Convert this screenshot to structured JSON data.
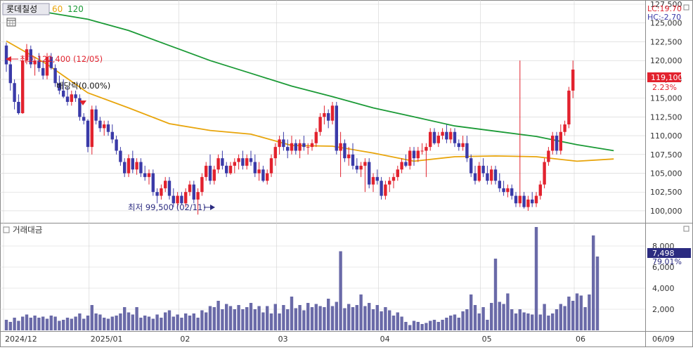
{
  "header": {
    "stock_name": "롯데칠성",
    "ma_short_label": "60",
    "ma_long_label": "120",
    "lc_label": "LC:19.70",
    "hc_label": "HC:-2.70",
    "volume_title": "거래대금"
  },
  "colors": {
    "up": "#e2222e",
    "down": "#3a3aa8",
    "ma60": "#e8a50c",
    "ma120": "#1b9a36",
    "volume": "#6a6aa8",
    "grid": "#d2d2d2",
    "current_tag": "#e2222e",
    "volume_tag": "#2b2b80"
  },
  "annotations": {
    "high_label": "최고 122,400 (12/05)",
    "low_label": "최저 99,500 (02/11)",
    "dividend_label": "배당락(0.00%)",
    "current_price_tag": "119,100",
    "current_change": "2.23%",
    "volume_tag": "7,498",
    "volume_change": "79.01%"
  },
  "chart_data": [
    {
      "type": "candlestick",
      "title": "롯데칠성",
      "ylim": [
        98500,
        127500
      ],
      "y_ticks": [
        100000,
        102500,
        105000,
        107500,
        110000,
        112500,
        115000,
        117500,
        120000,
        122500,
        125000,
        127500
      ],
      "y_tick_labels": [
        "100,000",
        "102,500",
        "105,000",
        "107,500",
        "110,000",
        "112,500",
        "115,000",
        "117,500",
        "120,000",
        "122,500",
        "125,000",
        "127,500"
      ],
      "x_tick_labels": [
        "2024/12",
        "2025/01",
        "02",
        "03",
        "04",
        "05",
        "06",
        "06/09"
      ],
      "x_tick_indices": [
        0,
        21,
        43,
        67,
        92,
        117,
        140,
        152
      ],
      "candles": [
        [
          122000,
          122400,
          118500,
          119500
        ],
        [
          119500,
          120500,
          116000,
          117000
        ],
        [
          117000,
          117500,
          113500,
          114500
        ],
        [
          114500,
          115500,
          112800,
          113000
        ],
        [
          113000,
          120500,
          112900,
          120000
        ],
        [
          120000,
          122200,
          119500,
          121500
        ],
        [
          121500,
          122000,
          119000,
          119500
        ],
        [
          119500,
          120500,
          118000,
          120000
        ],
        [
          120000,
          121000,
          118500,
          119000
        ],
        [
          119000,
          120000,
          117500,
          118000
        ],
        [
          118000,
          121000,
          117500,
          120500
        ],
        [
          120500,
          121000,
          118800,
          119000
        ],
        [
          119000,
          119500,
          116500,
          117000
        ],
        [
          117000,
          118000,
          115500,
          116000
        ],
        [
          116000,
          117500,
          115000,
          115200
        ],
        [
          115200,
          116500,
          114000,
          114500
        ],
        [
          114500,
          116000,
          114000,
          115500
        ],
        [
          115500,
          116000,
          114500,
          115000
        ],
        [
          115000,
          115500,
          112000,
          112500
        ],
        [
          112500,
          113000,
          111500,
          112000
        ],
        [
          112000,
          112200,
          107800,
          108500
        ],
        [
          108500,
          114000,
          107500,
          113500
        ],
        [
          113500,
          114000,
          111500,
          112000
        ],
        [
          112000,
          112500,
          110500,
          111000
        ],
        [
          111000,
          112000,
          110000,
          111500
        ],
        [
          111500,
          112000,
          110000,
          110500
        ],
        [
          110500,
          111500,
          109000,
          109500
        ],
        [
          109500,
          110000,
          107500,
          108000
        ],
        [
          108000,
          108500,
          106000,
          106500
        ],
        [
          106500,
          107000,
          104500,
          105000
        ],
        [
          105000,
          107500,
          104500,
          107000
        ],
        [
          107000,
          108000,
          105000,
          105500
        ],
        [
          105500,
          107000,
          104800,
          106500
        ],
        [
          106500,
          107000,
          104500,
          105000
        ],
        [
          105000,
          106000,
          104000,
          104500
        ],
        [
          104500,
          105500,
          103500,
          105000
        ],
        [
          105000,
          105500,
          102000,
          102500
        ],
        [
          102500,
          103000,
          101000,
          102000
        ],
        [
          102000,
          103500,
          101500,
          103000
        ],
        [
          103000,
          104500,
          102500,
          104000
        ],
        [
          104000,
          104500,
          101500,
          102000
        ],
        [
          102000,
          103000,
          100500,
          101000
        ],
        [
          101000,
          102500,
          100500,
          102000
        ],
        [
          102000,
          102500,
          100800,
          101000
        ],
        [
          101000,
          103000,
          100500,
          102500
        ],
        [
          102500,
          104000,
          102000,
          103500
        ],
        [
          103500,
          104000,
          101000,
          101500
        ],
        [
          101500,
          103000,
          99500,
          102500
        ],
        [
          102500,
          105000,
          102000,
          104500
        ],
        [
          104500,
          106500,
          104000,
          106000
        ],
        [
          106000,
          107500,
          103500,
          104000
        ],
        [
          104000,
          106000,
          103500,
          105500
        ],
        [
          105500,
          107500,
          105000,
          107000
        ],
        [
          107000,
          108000,
          105500,
          106000
        ],
        [
          106000,
          106500,
          104500,
          105000
        ],
        [
          105000,
          106500,
          104800,
          106000
        ],
        [
          106000,
          107000,
          105000,
          106500
        ],
        [
          106500,
          107500,
          105500,
          107000
        ],
        [
          107000,
          108000,
          105500,
          106000
        ],
        [
          106000,
          107500,
          105500,
          107000
        ],
        [
          107000,
          108000,
          106000,
          106500
        ],
        [
          106500,
          107500,
          104500,
          105000
        ],
        [
          105000,
          106500,
          104000,
          105500
        ],
        [
          105500,
          106000,
          103800,
          104000
        ],
        [
          104000,
          105500,
          103500,
          105000
        ],
        [
          105000,
          107500,
          104500,
          107000
        ],
        [
          107000,
          109000,
          106000,
          108500
        ],
        [
          108500,
          110000,
          107500,
          109500
        ],
        [
          109500,
          110500,
          108000,
          108500
        ],
        [
          108500,
          109500,
          107000,
          108000
        ],
        [
          108000,
          110000,
          107500,
          109000
        ],
        [
          109000,
          109500,
          107500,
          108000
        ],
        [
          108000,
          109500,
          107000,
          109000
        ],
        [
          109000,
          110000,
          108000,
          108500
        ],
        [
          108500,
          109000,
          107500,
          108500
        ],
        [
          108500,
          109500,
          108000,
          109000
        ],
        [
          109000,
          111000,
          108500,
          110500
        ],
        [
          110500,
          113000,
          110000,
          112500
        ],
        [
          112500,
          114000,
          111500,
          113000
        ],
        [
          113000,
          113500,
          111000,
          112000
        ],
        [
          112000,
          114500,
          111500,
          114000
        ],
        [
          114000,
          114500,
          107500,
          108000
        ],
        [
          108000,
          110500,
          104500,
          109000
        ],
        [
          109000,
          109500,
          106500,
          107000
        ],
        [
          107000,
          108500,
          106000,
          107500
        ],
        [
          107500,
          109000,
          105500,
          106000
        ],
        [
          106000,
          107000,
          105000,
          105500
        ],
        [
          105500,
          106500,
          104500,
          106000
        ],
        [
          106000,
          107000,
          102500,
          106500
        ],
        [
          106500,
          107000,
          103000,
          103500
        ],
        [
          103500,
          105000,
          102500,
          104500
        ],
        [
          104500,
          105500,
          103500,
          104000
        ],
        [
          104000,
          104500,
          101500,
          102000
        ],
        [
          102000,
          104000,
          101500,
          103500
        ],
        [
          103500,
          104500,
          102500,
          104000
        ],
        [
          104000,
          105000,
          103000,
          104500
        ],
        [
          104500,
          106000,
          104000,
          105500
        ],
        [
          105500,
          107000,
          105000,
          106500
        ],
        [
          106500,
          107500,
          105800,
          106000
        ],
        [
          106000,
          108500,
          105500,
          108000
        ],
        [
          108000,
          108500,
          106000,
          107000
        ],
        [
          107000,
          108500,
          106500,
          108000
        ],
        [
          108000,
          109000,
          107500,
          108000
        ],
        [
          108000,
          109000,
          104500,
          108500
        ],
        [
          108500,
          111000,
          108000,
          110500
        ],
        [
          110500,
          111000,
          108800,
          109000
        ],
        [
          109000,
          110500,
          108500,
          110000
        ],
        [
          110000,
          111000,
          109500,
          110500
        ],
        [
          110500,
          111500,
          109000,
          109500
        ],
        [
          109500,
          111000,
          109000,
          110500
        ],
        [
          110500,
          111000,
          108500,
          109000
        ],
        [
          109000,
          109500,
          108000,
          108500
        ],
        [
          108500,
          110000,
          108000,
          109000
        ],
        [
          109000,
          110000,
          106500,
          107000
        ],
        [
          107000,
          107500,
          104500,
          105000
        ],
        [
          105000,
          106000,
          103500,
          104000
        ],
        [
          104000,
          106500,
          103800,
          106000
        ],
        [
          106000,
          107000,
          104500,
          105000
        ],
        [
          105000,
          106000,
          103500,
          104000
        ],
        [
          104000,
          106000,
          103500,
          105500
        ],
        [
          105500,
          106000,
          103500,
          104000
        ],
        [
          104000,
          105000,
          102500,
          103000
        ],
        [
          103000,
          104000,
          102000,
          102500
        ],
        [
          102500,
          103500,
          101800,
          103000
        ],
        [
          103000,
          103500,
          101500,
          102000
        ],
        [
          102000,
          102500,
          100500,
          101000
        ],
        [
          101000,
          120000,
          100500,
          102000
        ],
        [
          102000,
          102500,
          100300,
          100500
        ],
        [
          100500,
          102000,
          100000,
          101500
        ],
        [
          101500,
          102500,
          100500,
          101000
        ],
        [
          101000,
          102500,
          100500,
          102000
        ],
        [
          102000,
          104000,
          101500,
          103500
        ],
        [
          103500,
          107000,
          103000,
          106500
        ],
        [
          106500,
          108500,
          106000,
          108000
        ],
        [
          108000,
          110500,
          107500,
          110000
        ],
        [
          110000,
          110500,
          107500,
          108000
        ],
        [
          108000,
          111500,
          107500,
          110500
        ],
        [
          110500,
          112000,
          110000,
          111500
        ],
        [
          111500,
          116500,
          111000,
          116000
        ],
        [
          116000,
          120000,
          115000,
          118800
        ]
      ],
      "ma60": [
        [
          0,
          122600
        ],
        [
          10,
          119500
        ],
        [
          20,
          115700
        ],
        [
          30,
          113700
        ],
        [
          40,
          111600
        ],
        [
          50,
          110700
        ],
        [
          60,
          110200
        ],
        [
          70,
          108700
        ],
        [
          80,
          108600
        ],
        [
          90,
          107700
        ],
        [
          100,
          106600
        ],
        [
          110,
          107200
        ],
        [
          120,
          107300
        ],
        [
          130,
          107200
        ],
        [
          140,
          106600
        ],
        [
          149,
          106900
        ]
      ],
      "ma120": [
        [
          0,
          127500
        ],
        [
          10,
          126400
        ],
        [
          20,
          125500
        ],
        [
          30,
          124000
        ],
        [
          40,
          122000
        ],
        [
          50,
          120000
        ],
        [
          60,
          118300
        ],
        [
          70,
          116600
        ],
        [
          80,
          115200
        ],
        [
          90,
          113700
        ],
        [
          100,
          112500
        ],
        [
          110,
          111300
        ],
        [
          120,
          110600
        ],
        [
          130,
          109900
        ],
        [
          140,
          108800
        ],
        [
          149,
          108000
        ]
      ]
    },
    {
      "type": "bar",
      "title": "거래대금",
      "ylim": [
        0,
        10000
      ],
      "y_ticks": [
        2000,
        4000,
        6000,
        8000
      ],
      "y_tick_labels": [
        "2,000",
        "4,000",
        "6,000",
        "8,000"
      ],
      "values": [
        1000,
        800,
        1200,
        900,
        1300,
        1500,
        1200,
        1400,
        1200,
        1300,
        1100,
        1400,
        1300,
        900,
        1000,
        1200,
        1100,
        1300,
        1600,
        1100,
        1400,
        2400,
        1600,
        1500,
        1200,
        1100,
        1300,
        1400,
        1600,
        2200,
        1700,
        1500,
        2200,
        1200,
        1400,
        1300,
        1100,
        1500,
        1200,
        1700,
        1900,
        1300,
        1500,
        1200,
        1600,
        1400,
        1600,
        1200,
        1900,
        1700,
        2300,
        2200,
        2800,
        2000,
        2500,
        2300,
        2000,
        2400,
        2000,
        2200,
        2600,
        2000,
        2300,
        1700,
        2300,
        1600,
        2500,
        1600,
        2400,
        2000,
        3200,
        2100,
        2400,
        1900,
        2600,
        2200,
        2500,
        2300,
        2200,
        3000,
        2300,
        2700,
        7500,
        2100,
        2500,
        2200,
        2400,
        3400,
        2300,
        2600,
        2000,
        2400,
        1800,
        2200,
        1900,
        1400,
        1700,
        1300,
        800,
        500,
        900,
        800,
        600,
        700,
        900,
        1000,
        800,
        1000,
        1200,
        1400,
        1500,
        1200,
        1800,
        2000,
        3400,
        2400,
        1600,
        2200,
        1000,
        2600,
        6800,
        2700,
        2500,
        3500,
        2000,
        1600,
        2000,
        1700,
        1600,
        1500,
        9800,
        1500,
        2500,
        1400,
        1600,
        2000,
        2500,
        2300,
        3200,
        2800,
        3500,
        3300,
        2200,
        3400,
        9000,
        7000
      ]
    }
  ]
}
